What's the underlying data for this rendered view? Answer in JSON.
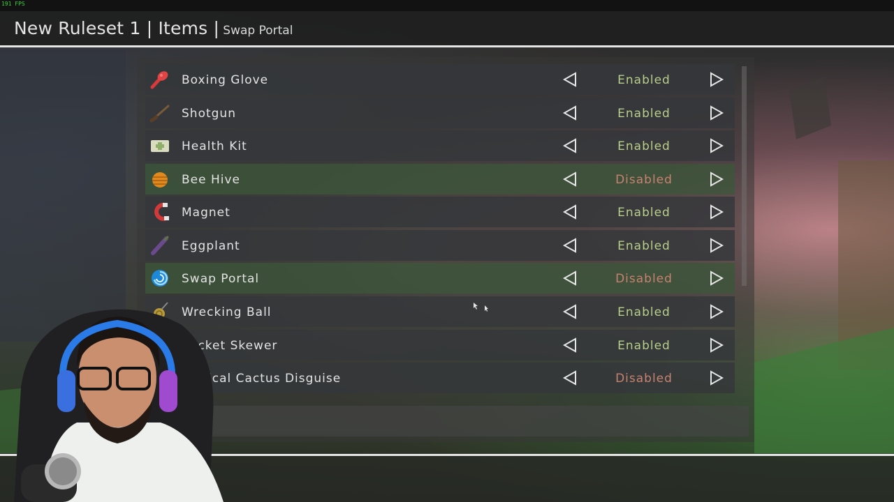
{
  "overlay": {
    "fps_label": "191 FPS"
  },
  "header": {
    "ruleset": "New Ruleset 1 | Items |",
    "current_item": "Swap Portal"
  },
  "colors": {
    "enabled": "#b7cf8a",
    "disabled": "#c78370",
    "row_default": "#34373a",
    "row_disabled": "#3c563a",
    "title_text": "#e4e4e4"
  },
  "items": [
    {
      "name": "Boxing Glove",
      "status": "Enabled",
      "icon": "boxing-glove-icon"
    },
    {
      "name": "Shotgun",
      "status": "Enabled",
      "icon": "shotgun-icon"
    },
    {
      "name": "Health Kit",
      "status": "Enabled",
      "icon": "health-kit-icon"
    },
    {
      "name": "Bee Hive",
      "status": "Disabled",
      "icon": "bee-hive-icon"
    },
    {
      "name": "Magnet",
      "status": "Enabled",
      "icon": "magnet-icon"
    },
    {
      "name": "Eggplant",
      "status": "Enabled",
      "icon": "eggplant-icon"
    },
    {
      "name": "Swap Portal",
      "status": "Disabled",
      "icon": "swap-portal-icon"
    },
    {
      "name": "Wrecking Ball",
      "status": "Enabled",
      "icon": "wrecking-ball-icon"
    },
    {
      "name": "Rocket Skewer",
      "status": "Enabled",
      "icon": "rocket-skewer-icon"
    },
    {
      "name": "Tactical Cactus Disguise",
      "status": "Disabled",
      "icon": "cactus-disguise-icon"
    }
  ]
}
